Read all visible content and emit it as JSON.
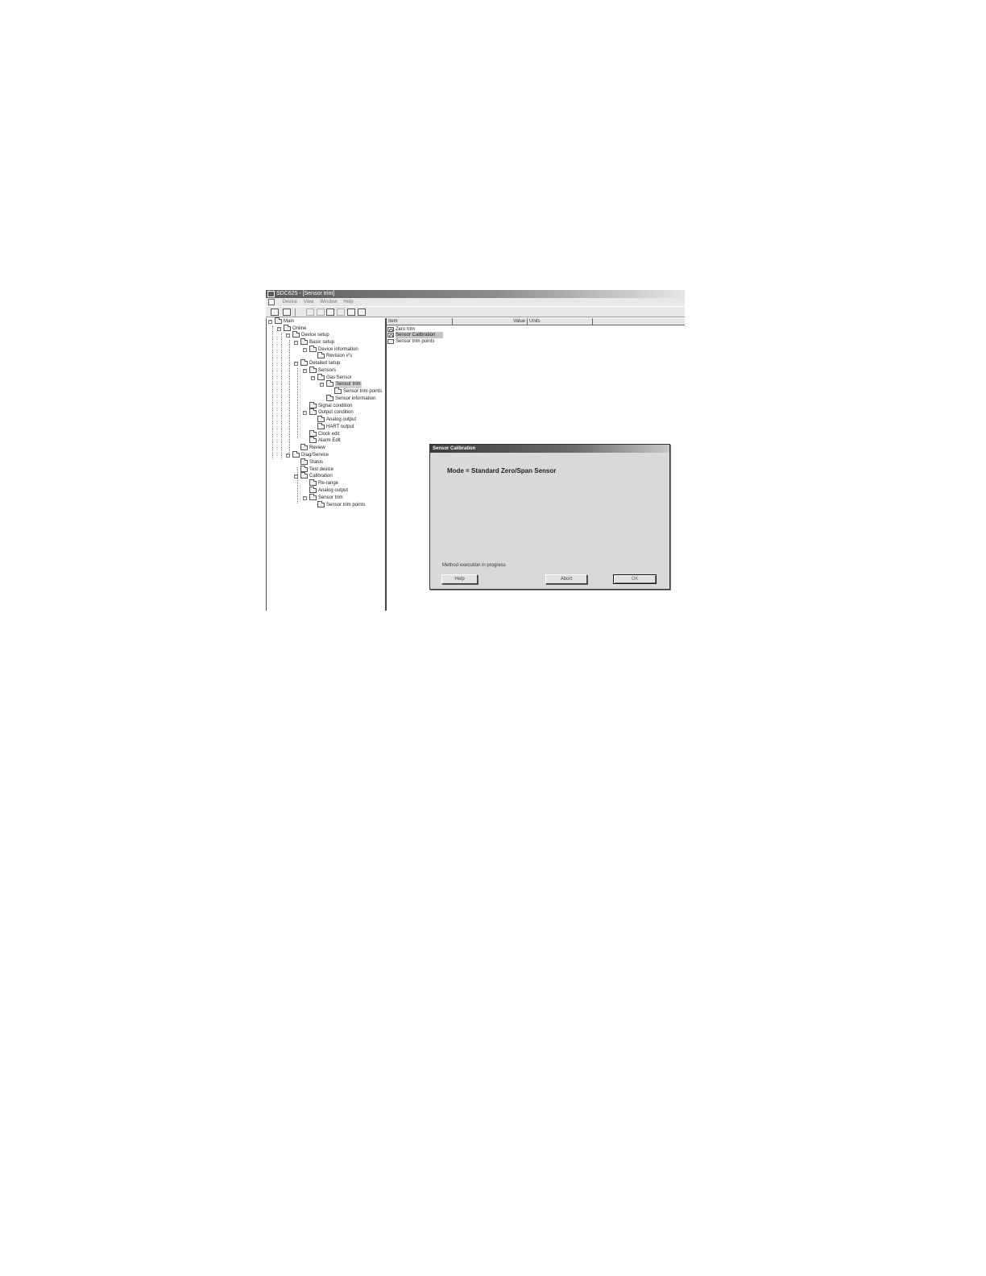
{
  "window": {
    "title": "SDC625 - [Sensor trim]"
  },
  "menubar": {
    "items": [
      "Device",
      "View",
      "Window",
      "Help"
    ]
  },
  "tree": {
    "nodes": [
      {
        "label": "Main",
        "expander": "−"
      },
      {
        "label": "Online",
        "expander": "−"
      },
      {
        "label": "Device setup",
        "expander": "−"
      },
      {
        "label": "Basic setup",
        "expander": "−"
      },
      {
        "label": "Device information",
        "expander": "−"
      },
      {
        "label": "Revision #'s",
        "expander": ""
      },
      {
        "label": "Detailed setup",
        "expander": "−"
      },
      {
        "label": "Sensors",
        "expander": "−"
      },
      {
        "label": "Gas Sensor",
        "expander": "−"
      },
      {
        "label": "Sensor trim",
        "expander": "−"
      },
      {
        "label": "Sensor trim points",
        "expander": ""
      },
      {
        "label": "Sensor information",
        "expander": ""
      },
      {
        "label": "Signal condition",
        "expander": ""
      },
      {
        "label": "Output condition",
        "expander": "−"
      },
      {
        "label": "Analog output",
        "expander": ""
      },
      {
        "label": "HART output",
        "expander": ""
      },
      {
        "label": "Clock edit",
        "expander": ""
      },
      {
        "label": "Alarm Edit",
        "expander": ""
      },
      {
        "label": "Review",
        "expander": ""
      },
      {
        "label": "Diag/Service",
        "expander": "−"
      },
      {
        "label": "Status",
        "expander": ""
      },
      {
        "label": "Test device",
        "expander": ""
      },
      {
        "label": "Calibration",
        "expander": "−"
      },
      {
        "label": "Re-range",
        "expander": ""
      },
      {
        "label": "Analog output",
        "expander": ""
      },
      {
        "label": "Sensor trim",
        "expander": "−"
      },
      {
        "label": "Sensor trim points",
        "expander": ""
      }
    ]
  },
  "list": {
    "columns": [
      "Item",
      "Value",
      "Units"
    ],
    "rows": [
      {
        "label": "Zero trim",
        "icon": "method-icon"
      },
      {
        "label": "Sensor Calibration",
        "icon": "method-icon"
      },
      {
        "label": "Sensor trim points",
        "icon": "folder-icon"
      }
    ]
  },
  "dialog": {
    "title": "Sensor Calibration",
    "mode_text": "Mode = Standard Zero/Span Sensor",
    "status_text": "Method execution in progress",
    "buttons": {
      "help": "Help",
      "abort": "Abort",
      "ok": "OK"
    }
  }
}
